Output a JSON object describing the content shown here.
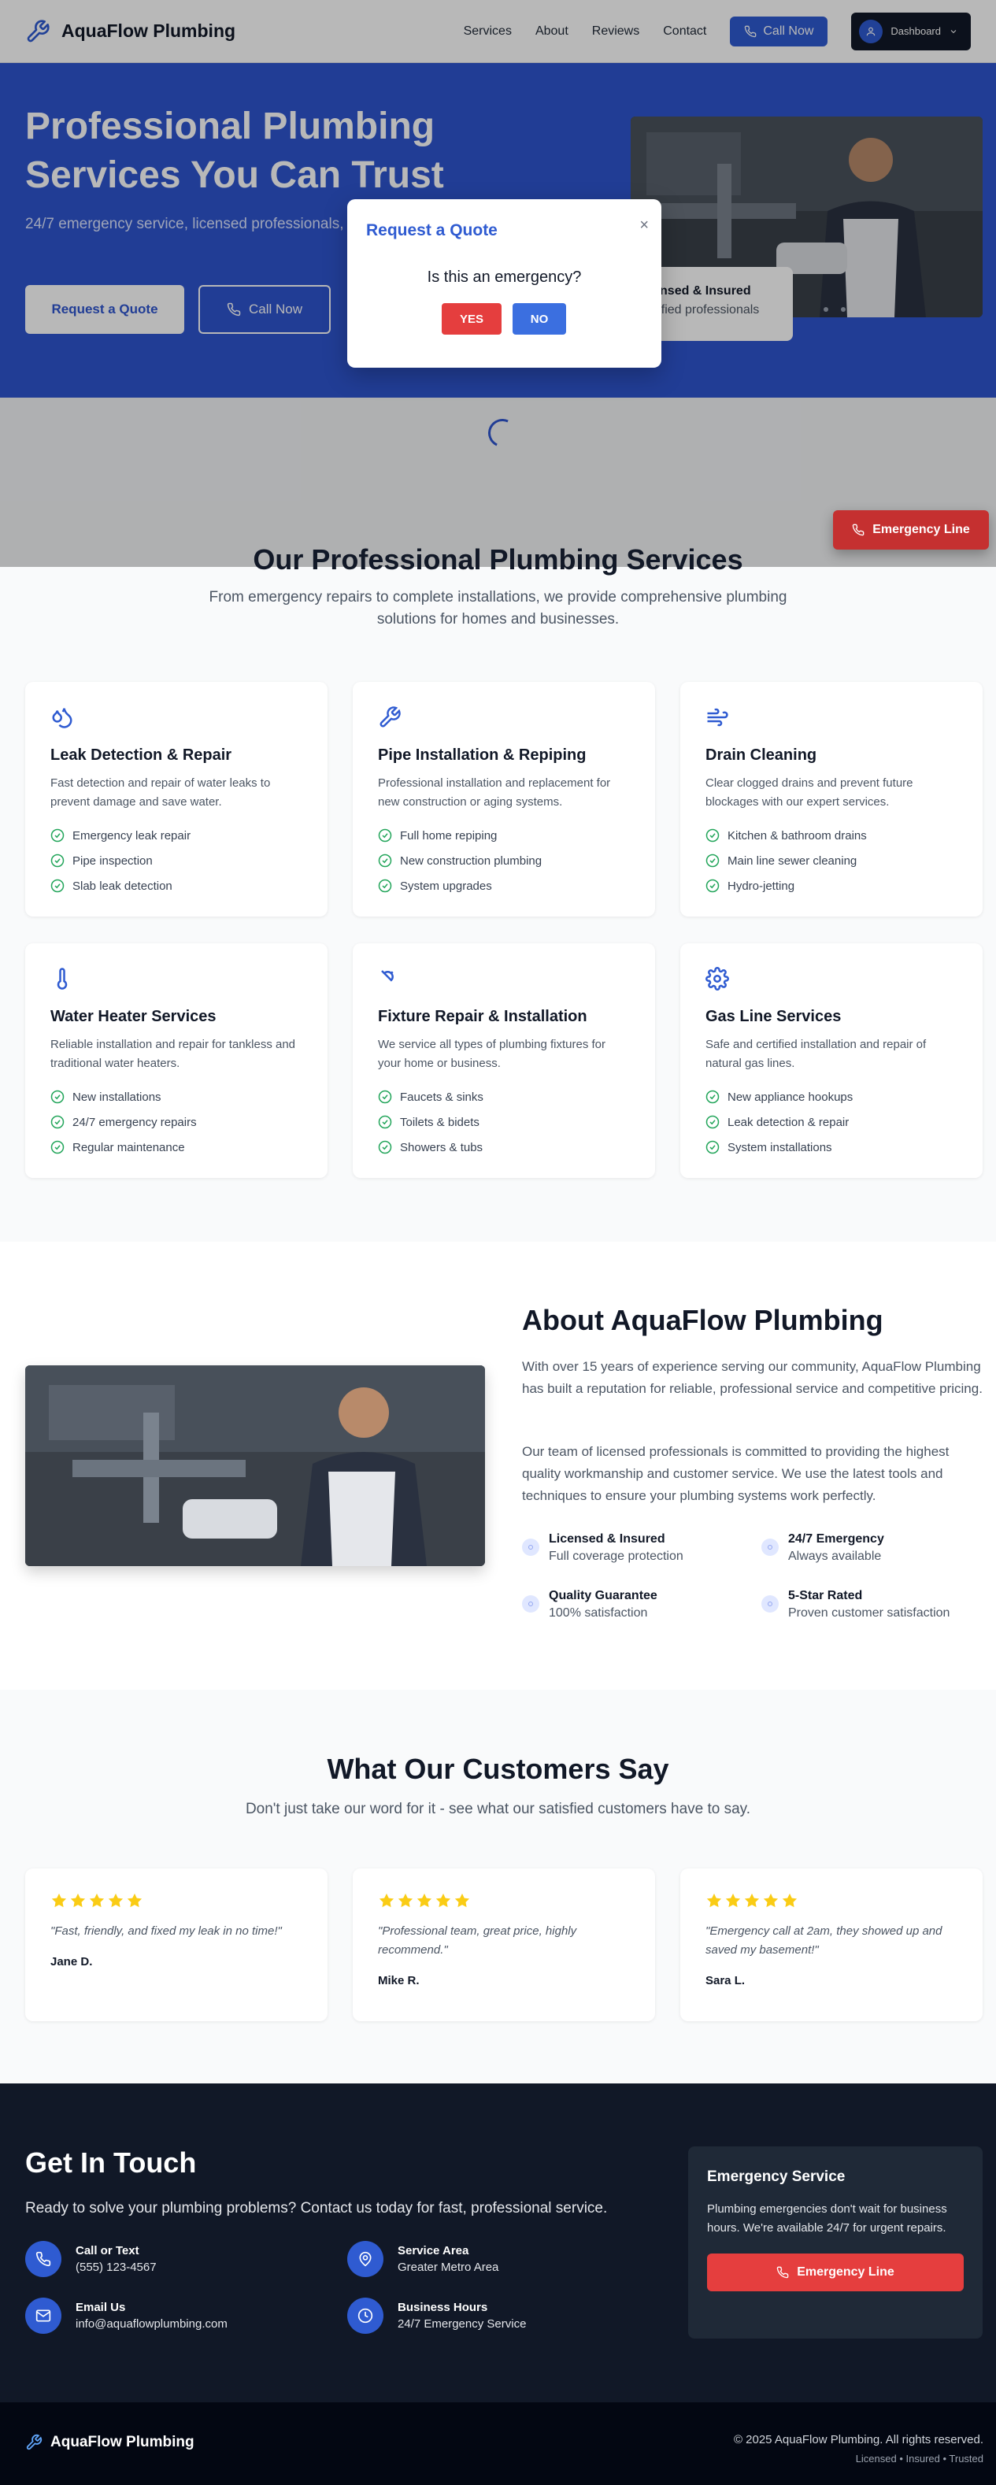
{
  "brand": {
    "name": "AquaFlow Plumbing"
  },
  "nav": {
    "items": [
      "Services",
      "About",
      "Reviews",
      "Contact"
    ],
    "call_now": "Call Now",
    "dashboard": "Dashboard"
  },
  "hero": {
    "title": "Professional Plumbing Services You Can Trust",
    "subtitle": "24/7 emergency service, licensed professionals, and guaranteed satisfaction. Serving your community for over 15 years.",
    "quote_button": "Request a Quote",
    "call_button": "Call Now",
    "badge_title": "Licensed & Insured",
    "badge_sub": "Certified professionals"
  },
  "modal": {
    "title": "Request a Quote",
    "close": "×",
    "question": "Is this an emergency?",
    "yes": "YES",
    "no": "NO"
  },
  "floating": {
    "emergency": "Emergency Line"
  },
  "services": {
    "title": "Our Professional Plumbing Services",
    "subtitle": "From emergency repairs to complete installations, we provide comprehensive plumbing solutions for homes and businesses.",
    "cards": [
      {
        "icon": "droplets-icon",
        "title": "Leak Detection & Repair",
        "desc": "Fast detection and repair of water leaks to prevent damage and save water.",
        "items": [
          "Emergency leak repair",
          "Pipe inspection",
          "Slab leak detection"
        ]
      },
      {
        "icon": "wrench-icon",
        "title": "Pipe Installation & Repiping",
        "desc": "Professional installation and replacement for new construction or aging systems.",
        "items": [
          "Full home repiping",
          "New construction plumbing",
          "System upgrades"
        ]
      },
      {
        "icon": "wind-icon",
        "title": "Drain Cleaning",
        "desc": "Clear clogged drains and prevent future blockages with our expert services.",
        "items": [
          "Kitchen & bathroom drains",
          "Main line sewer cleaning",
          "Hydro-jetting"
        ]
      },
      {
        "icon": "thermometer-icon",
        "title": "Water Heater Services",
        "desc": "Reliable installation and repair for tankless and traditional water heaters.",
        "items": [
          "New installations",
          "24/7 emergency repairs",
          "Regular maintenance"
        ]
      },
      {
        "icon": "shower-icon",
        "title": "Fixture Repair & Installation",
        "desc": "We service all types of plumbing fixtures for your home or business.",
        "items": [
          "Faucets & sinks",
          "Toilets & bidets",
          "Showers & tubs"
        ]
      },
      {
        "icon": "gear-icon",
        "title": "Gas Line Services",
        "desc": "Safe and certified installation and repair of natural gas lines.",
        "items": [
          "New appliance hookups",
          "Leak detection & repair",
          "System installations"
        ]
      }
    ]
  },
  "about": {
    "title": "About AquaFlow Plumbing",
    "p1": "With over 15 years of experience serving our community, AquaFlow Plumbing has built a reputation for reliable, professional service and competitive pricing.",
    "p2": "Our team of licensed professionals is committed to providing the highest quality workmanship and customer service. We use the latest tools and techniques to ensure your plumbing systems work perfectly.",
    "features": [
      {
        "title": "Licensed & Insured",
        "sub": "Full coverage protection"
      },
      {
        "title": "24/7 Emergency",
        "sub": "Always available"
      },
      {
        "title": "Quality Guarantee",
        "sub": "100% satisfaction"
      },
      {
        "title": "5-Star Rated",
        "sub": "Proven customer satisfaction"
      }
    ]
  },
  "testimonials": {
    "title": "What Our Customers Say",
    "subtitle": "Don't just take our word for it - see what our satisfied customers have to say.",
    "star_color": "#facc15",
    "items": [
      {
        "rating": 5,
        "quote": "\"Fast, friendly, and fixed my leak in no time!\"",
        "name": "Jane D."
      },
      {
        "rating": 5,
        "quote": "\"Professional team, great price, highly recommend.\"",
        "name": "Mike R."
      },
      {
        "rating": 5,
        "quote": "\"Emergency call at 2am, they showed up and saved my basement!\"",
        "name": "Sara L."
      }
    ]
  },
  "contact": {
    "title": "Get In Touch",
    "subtitle": "Ready to solve your plumbing problems? Contact us today for fast, professional service.",
    "items": [
      {
        "icon": "phone-icon",
        "label": "Call or Text",
        "value": "(555) 123-4567"
      },
      {
        "icon": "map-pin-icon",
        "label": "Service Area",
        "value": "Greater Metro Area"
      },
      {
        "icon": "mail-icon",
        "label": "Email Us",
        "value": "info@aquaflowplumbing.com"
      },
      {
        "icon": "clock-icon",
        "label": "Business Hours",
        "value": "24/7 Emergency Service"
      }
    ],
    "emergency": {
      "title": "Emergency Service",
      "text": "Plumbing emergencies don't wait for business hours. We're available 24/7 for urgent repairs.",
      "button": "Emergency Line"
    }
  },
  "footer": {
    "brand": "AquaFlow Plumbing",
    "copyright": "© 2025 AquaFlow Plumbing. All rights reserved.",
    "tagline": "Licensed • Insured • Trusted"
  },
  "colors": {
    "primary": "#2f5bd1",
    "danger": "#e53e3e",
    "dark": "#111827"
  }
}
